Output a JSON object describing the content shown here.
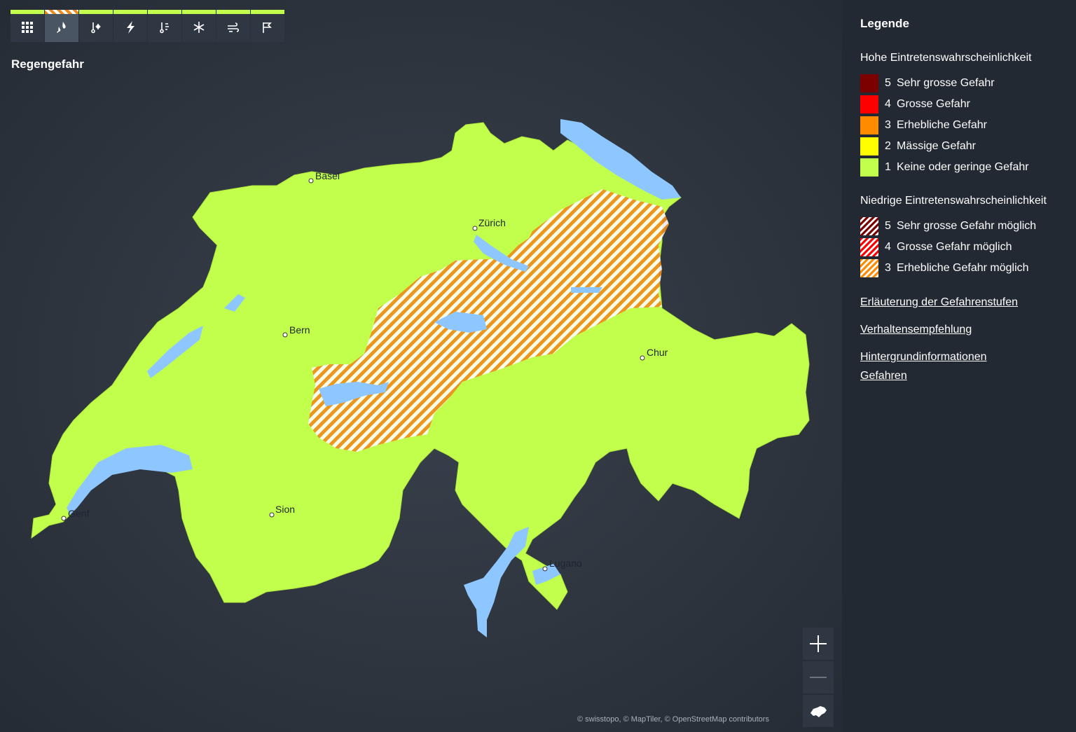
{
  "toolbar": {
    "buttons": [
      {
        "icon": "grid-icon",
        "strip": "green"
      },
      {
        "icon": "rain-icon",
        "strip": "orange-hatch",
        "active": true
      },
      {
        "icon": "thermometer-snow-icon",
        "strip": "green"
      },
      {
        "icon": "lightning-icon",
        "strip": "green"
      },
      {
        "icon": "thermometer-heat-icon",
        "strip": "green"
      },
      {
        "icon": "snowflake-icon",
        "strip": "green"
      },
      {
        "icon": "wind-icon",
        "strip": "green"
      },
      {
        "icon": "slippery-road-icon",
        "strip": "green"
      }
    ]
  },
  "layer_title": "Regengefahr",
  "map": {
    "cities": [
      {
        "name": "Basel"
      },
      {
        "name": "Zürich"
      },
      {
        "name": "Bern"
      },
      {
        "name": "Chur"
      },
      {
        "name": "Genf"
      },
      {
        "name": "Sion"
      },
      {
        "name": "Lugano"
      }
    ],
    "attribution": "© swisstopo, © MapTiler, © OpenStreetMap contributors",
    "colors": {
      "level1": "#c1ff4c",
      "level3_hatch": "#f08a1a",
      "water": "#8ec7ff",
      "background": "#2a313b"
    }
  },
  "zoom": {
    "in_icon": "plus-icon",
    "out_icon": "minus-icon",
    "reset_icon": "switzerland-icon"
  },
  "legend": {
    "title": "Legende",
    "high_title": "Hohe Eintretenswahrscheinlichkeit",
    "high_items": [
      {
        "level": "5",
        "label": "Sehr grosse Gefahr",
        "color": "#7b0000"
      },
      {
        "level": "4",
        "label": "Grosse Gefahr",
        "color": "#ff0000"
      },
      {
        "level": "3",
        "label": "Erhebliche Gefahr",
        "color": "#ff8b00"
      },
      {
        "level": "2",
        "label": "Mässige Gefahr",
        "color": "#ffff00"
      },
      {
        "level": "1",
        "label": "Keine oder geringe Gefahr",
        "color": "#c1ff4c"
      }
    ],
    "low_title": "Niedrige Eintretenswahrscheinlichkeit",
    "low_items": [
      {
        "level": "5",
        "label": "Sehr grosse Gefahr möglich",
        "color": "#7b0000"
      },
      {
        "level": "4",
        "label": "Grosse Gefahr möglich",
        "color": "#ff0000"
      },
      {
        "level": "3",
        "label": "Erhebliche Gefahr möglich",
        "color": "#ff8b00"
      }
    ],
    "links": [
      "Erläuterung der Gefahrenstufen",
      "Verhaltensempfehlung",
      "Hintergrundinformationen Gefahren"
    ]
  }
}
